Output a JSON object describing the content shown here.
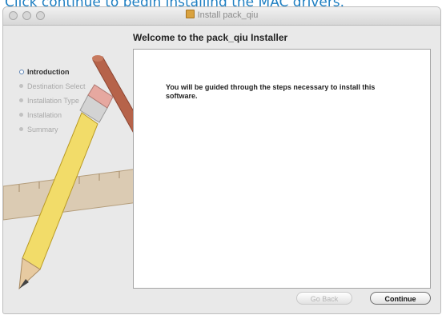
{
  "caption": "Click continue to begin installing the MAC drivers.",
  "window": {
    "title": "Install pack_qiu",
    "heading": "Welcome to the pack_qiu Installer"
  },
  "steps": [
    {
      "label": "Introduction",
      "active": true
    },
    {
      "label": "Destination Select",
      "active": false
    },
    {
      "label": "Installation Type",
      "active": false
    },
    {
      "label": "Installation",
      "active": false
    },
    {
      "label": "Summary",
      "active": false
    }
  ],
  "content": {
    "message": "You will be guided through the steps necessary to install this software."
  },
  "buttons": {
    "back": "Go Back",
    "continue": "Continue"
  }
}
